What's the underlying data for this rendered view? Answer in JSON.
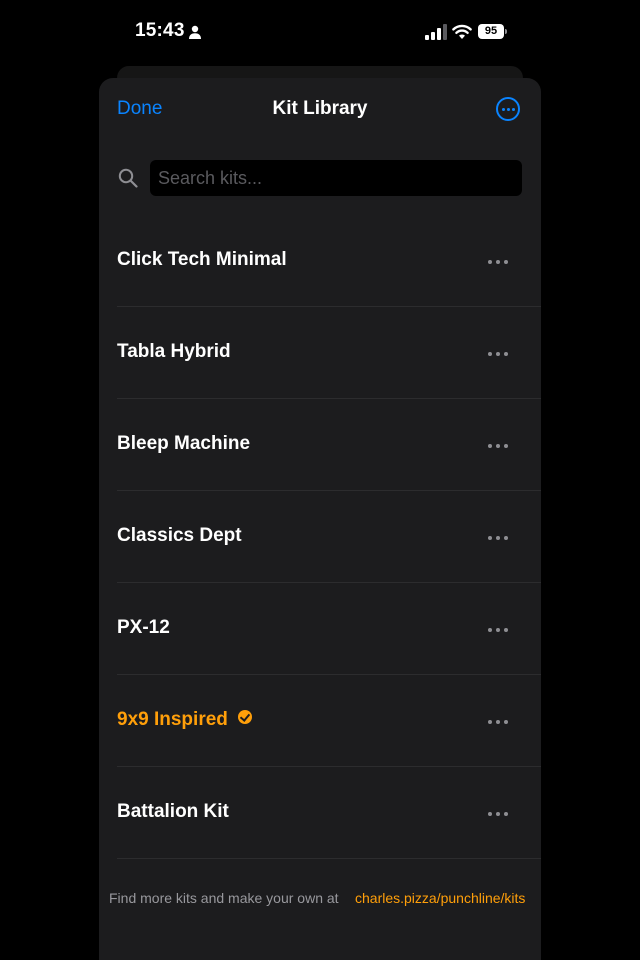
{
  "status_bar": {
    "time": "15:43",
    "battery": "95",
    "icons": [
      "person-icon",
      "cellular-signal-icon",
      "wifi-icon",
      "battery-icon"
    ]
  },
  "nav": {
    "done_label": "Done",
    "title": "Kit Library",
    "more_icon": "ellipsis-circle-icon"
  },
  "search": {
    "placeholder": "Search kits...",
    "value": "",
    "icon": "search-icon"
  },
  "kits": [
    {
      "name": "Click Tech Minimal",
      "selected": false
    },
    {
      "name": "Tabla Hybrid",
      "selected": false
    },
    {
      "name": "Bleep Machine",
      "selected": false
    },
    {
      "name": "Classics Dept",
      "selected": false
    },
    {
      "name": "PX-12",
      "selected": false
    },
    {
      "name": "9x9 Inspired",
      "selected": true
    },
    {
      "name": "Battalion Kit",
      "selected": false
    }
  ],
  "footer": {
    "text": "Find more kits and make your own at",
    "link": "charles.pizza/punchline/kits"
  },
  "colors": {
    "accent_blue": "#0a84ff",
    "selected_orange": "#ff9f0a",
    "sheet_background": "#1c1c1e",
    "background": "#000000"
  }
}
